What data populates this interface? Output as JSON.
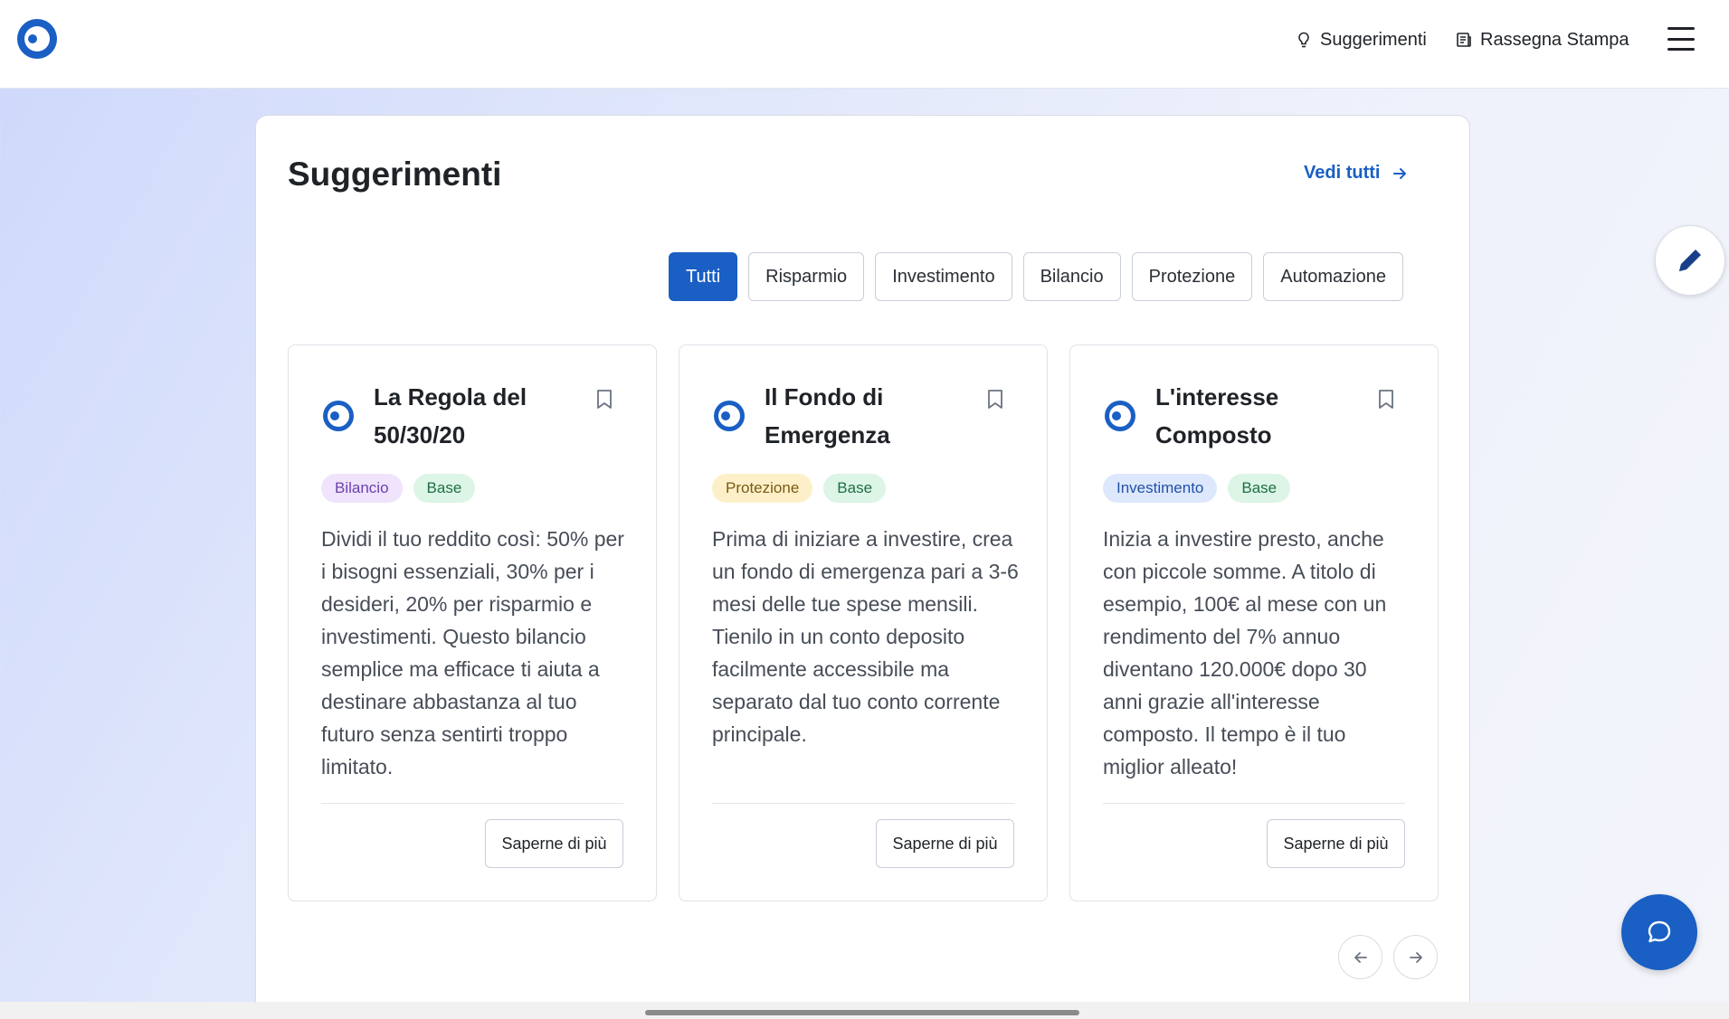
{
  "header": {
    "nav": [
      {
        "label": "Suggerimenti",
        "icon": "lightbulb-icon"
      },
      {
        "label": "Rassegna Stampa",
        "icon": "newspaper-icon"
      }
    ],
    "menu_icon": "hamburger-icon"
  },
  "section": {
    "title": "Suggerimenti",
    "see_all": "Vedi tutti"
  },
  "filters": [
    "Tutti",
    "Risparmio",
    "Investimento",
    "Bilancio",
    "Protezione",
    "Automazione"
  ],
  "active_filter": "Tutti",
  "cards": [
    {
      "title": "La Regola del 50/30/20",
      "tags": [
        {
          "label": "Bilancio",
          "color": "purple"
        },
        {
          "label": "Base",
          "color": "green"
        }
      ],
      "text": "Dividi il tuo reddito così: 50% per i bisogni essenziali, 30% per i desideri, 20% per risparmio e investimenti. Questo bilancio semplice ma efficace ti aiuta a destinare abbastanza al tuo futuro senza sentirti troppo limitato.",
      "button": "Saperne di più"
    },
    {
      "title": "Il Fondo di Emergenza",
      "tags": [
        {
          "label": "Protezione",
          "color": "yellow"
        },
        {
          "label": "Base",
          "color": "green"
        }
      ],
      "text": "Prima di iniziare a investire, crea un fondo di emergenza pari a 3-6 mesi delle tue spese mensili. Tienilo in un conto deposito facilmente accessibile ma separato dal tuo conto corrente principale.",
      "button": "Saperne di più"
    },
    {
      "title": "L'interesse Composto",
      "tags": [
        {
          "label": "Investimento",
          "color": "blue"
        },
        {
          "label": "Base",
          "color": "green"
        }
      ],
      "text": "Inizia a investire presto, anche con piccole somme. A titolo di esempio, 100€ al mese con un rendimento del 7% annuo diventano 120.000€ dopo 30 anni grazie all'interesse composto. Il tempo è il tuo miglior alleato!",
      "button": "Saperne di più"
    }
  ],
  "colors": {
    "accent": "#1a5fc4"
  }
}
